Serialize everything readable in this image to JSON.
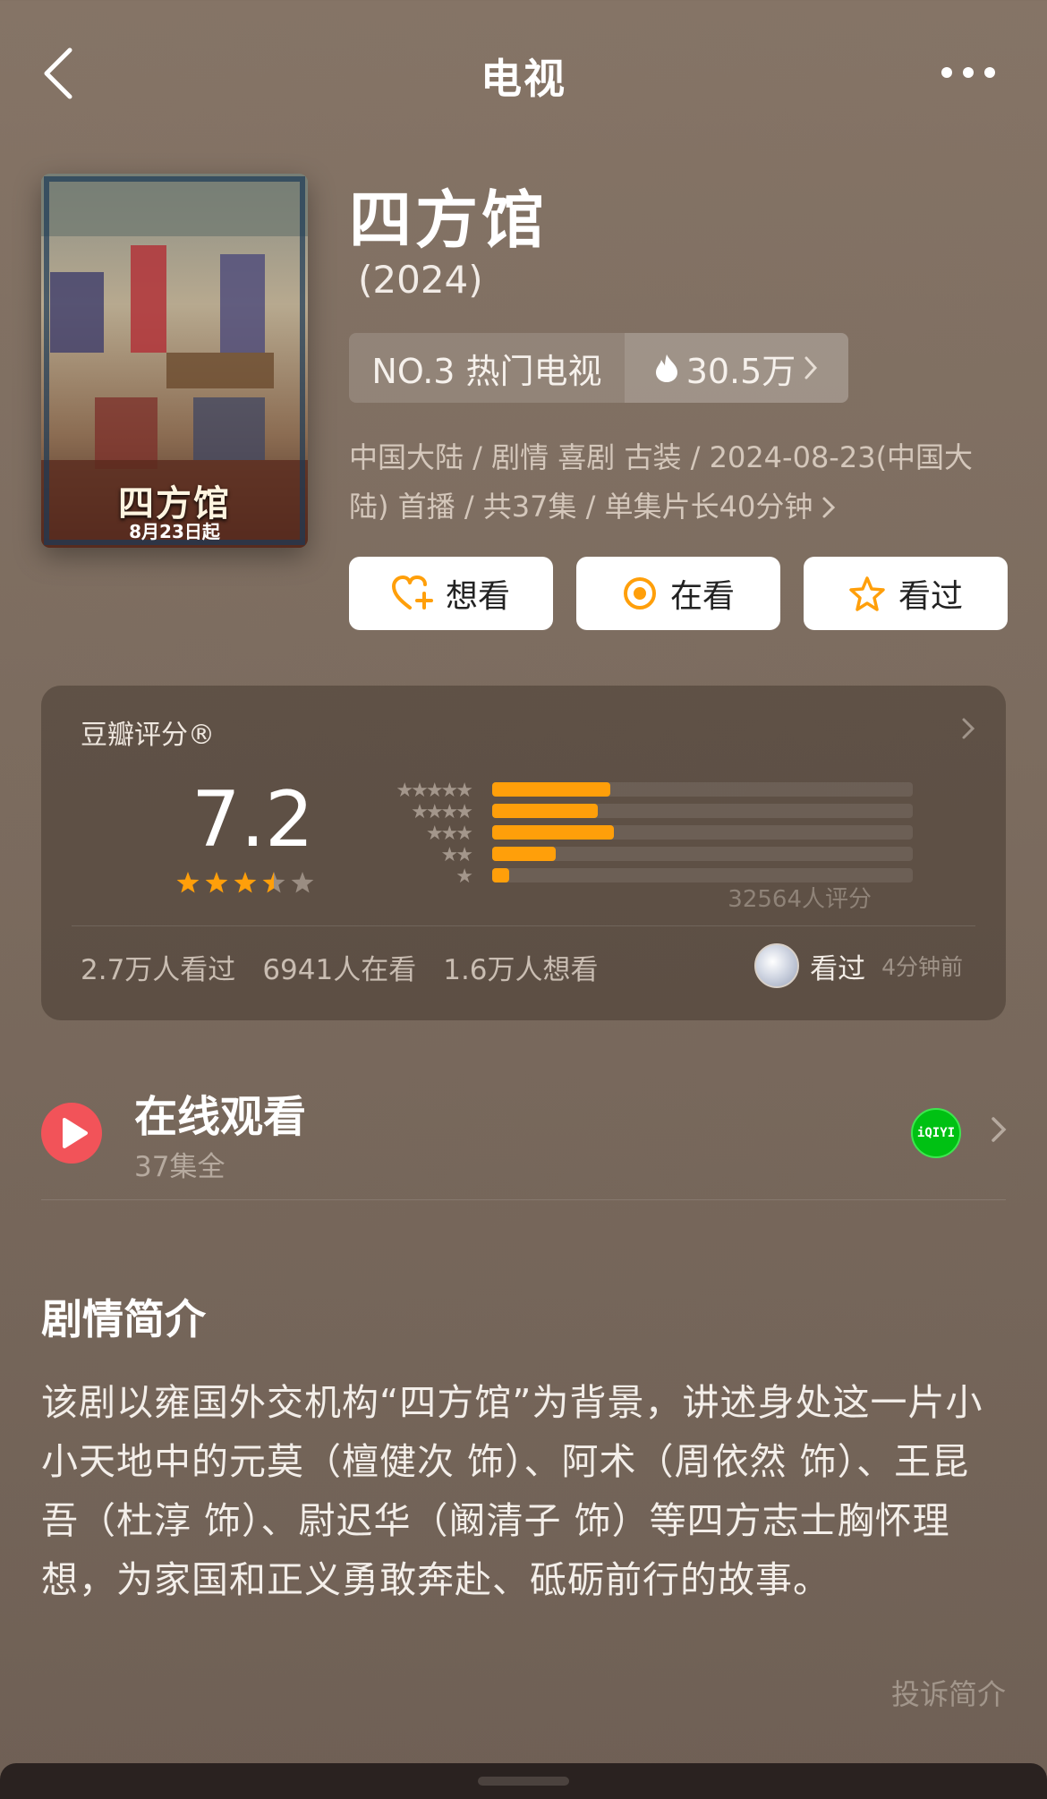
{
  "nav": {
    "title": "电视"
  },
  "show": {
    "title": "四方馆",
    "year": "(2024)",
    "poster_title": "四方馆",
    "poster_date": "8月23日起",
    "rank_label": "NO.3 热门电视",
    "heat": "30.5万",
    "meta_line1": "中国大陆 / 剧情 喜剧 古装 / 2024-08-23(中国大",
    "meta_line2": "陆) 首播 / 共37集 / 单集片长40分钟"
  },
  "actions": [
    {
      "label": "想看",
      "icon": "heart-plus-icon"
    },
    {
      "label": "在看",
      "icon": "target-icon"
    },
    {
      "label": "看过",
      "icon": "star-outline-icon"
    }
  ],
  "rating": {
    "label": "豆瓣评分®",
    "score": "7.2",
    "star_rating": 3.5,
    "distribution": [
      {
        "stars": "★★★★★",
        "fraction": 0.28
      },
      {
        "stars": "★★★★",
        "fraction": 0.25
      },
      {
        "stars": "★★★",
        "fraction": 0.29
      },
      {
        "stars": "★★",
        "fraction": 0.15
      },
      {
        "stars": "★",
        "fraction": 0.04
      }
    ],
    "count_text": "32564人评分",
    "stats": [
      "2.7万人看过",
      "6941人在看",
      "1.6万人想看"
    ],
    "recent_action": "看过",
    "recent_time": "4分钟前"
  },
  "online": {
    "title": "在线观看",
    "subtitle": "37集全",
    "platform_icon": "iqiyi-icon",
    "platform_text": "iQIYI"
  },
  "synopsis": {
    "title": "剧情简介",
    "text": "该剧以雍国外交机构“四方馆”为背景，讲述身处这一片小小天地中的元莫（檀健次 饰）、阿术（周依然 饰）、王昆吾（杜淳 饰）、尉迟华（阚清子 饰）等四方志士胸怀理想，为家国和正义勇敢奔赴、砥砺前行的故事。",
    "report": "投诉简介"
  },
  "colors": {
    "accent_orange": "#ff9f0a",
    "play_red": "#f25359",
    "iqiyi_green": "#00c113"
  }
}
